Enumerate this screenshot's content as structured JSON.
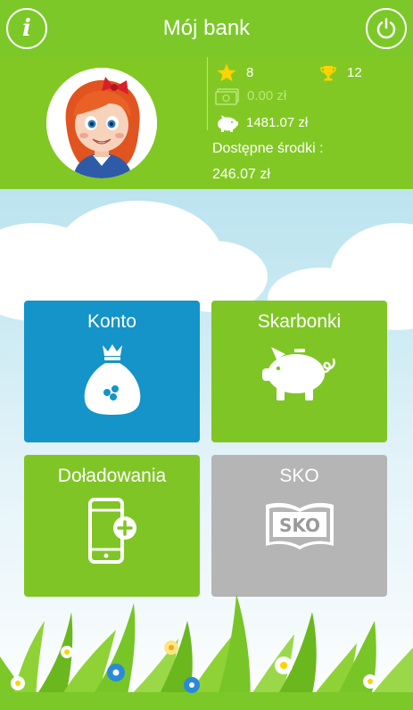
{
  "header": {
    "title": "Mój bank",
    "info_icon": "info-icon",
    "power_icon": "power-icon"
  },
  "profile": {
    "avatar": "girl-avatar",
    "stars": "8",
    "trophies": "12",
    "cash": "0.00 zł",
    "savings": "1481.07 zł",
    "available_label": "Dostępne środki :",
    "available_value": "246.07 zł"
  },
  "tiles": [
    {
      "label": "Konto",
      "icon": "money-bag-icon",
      "color": "#1494c8"
    },
    {
      "label": "Skarbonki",
      "icon": "piggy-bank-icon",
      "color": "#80c526"
    },
    {
      "label": "Doładowania",
      "icon": "phone-topup-icon",
      "color": "#80c526"
    },
    {
      "label": "SKO",
      "icon": "sko-book-icon",
      "color": "#b5b5b5"
    }
  ],
  "colors": {
    "brand_green": "#7cc829",
    "panel_green": "#82c824",
    "konto_blue": "#1494c8",
    "sko_gray": "#b5b5b5",
    "star_yellow": "#ffd200"
  }
}
